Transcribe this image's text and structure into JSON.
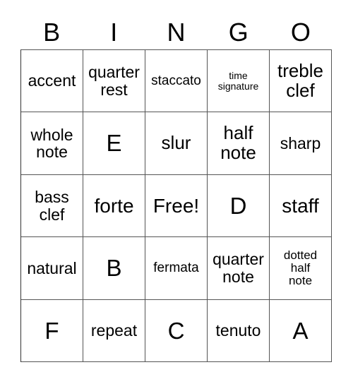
{
  "card": {
    "title": "BINGO",
    "free_space_label": "Free!",
    "columns": 5,
    "rows": 5,
    "text_color": "#000000",
    "background_color": "#ffffff",
    "border_color": "#555555"
  },
  "header": {
    "letters": [
      "B",
      "I",
      "N",
      "G",
      "O"
    ]
  },
  "grid": {
    "rows": [
      [
        {
          "label": "accent",
          "size": "md"
        },
        {
          "label": "quarter\nrest",
          "size": "md"
        },
        {
          "label": "staccato",
          "size": "sm"
        },
        {
          "label": "time\nsignature",
          "size": "xxs"
        },
        {
          "label": "treble\nclef",
          "size": "lg"
        }
      ],
      [
        {
          "label": "whole\nnote",
          "size": "md"
        },
        {
          "label": "E",
          "size": "xxl"
        },
        {
          "label": "slur",
          "size": "lg"
        },
        {
          "label": "half\nnote",
          "size": "lg"
        },
        {
          "label": "sharp",
          "size": "md"
        }
      ],
      [
        {
          "label": "bass\nclef",
          "size": "md"
        },
        {
          "label": "forte",
          "size": "xl"
        },
        {
          "label": "Free!",
          "size": "xl"
        },
        {
          "label": "D",
          "size": "xxl"
        },
        {
          "label": "staff",
          "size": "xl"
        }
      ],
      [
        {
          "label": "natural",
          "size": "md"
        },
        {
          "label": "B",
          "size": "xxl"
        },
        {
          "label": "fermata",
          "size": "sm"
        },
        {
          "label": "quarter\nnote",
          "size": "md"
        },
        {
          "label": "dotted\nhalf\nnote",
          "size": "xs"
        }
      ],
      [
        {
          "label": "F",
          "size": "xxl"
        },
        {
          "label": "repeat",
          "size": "md"
        },
        {
          "label": "C",
          "size": "xxl"
        },
        {
          "label": "tenuto",
          "size": "md"
        },
        {
          "label": "A",
          "size": "xxl"
        }
      ]
    ]
  }
}
